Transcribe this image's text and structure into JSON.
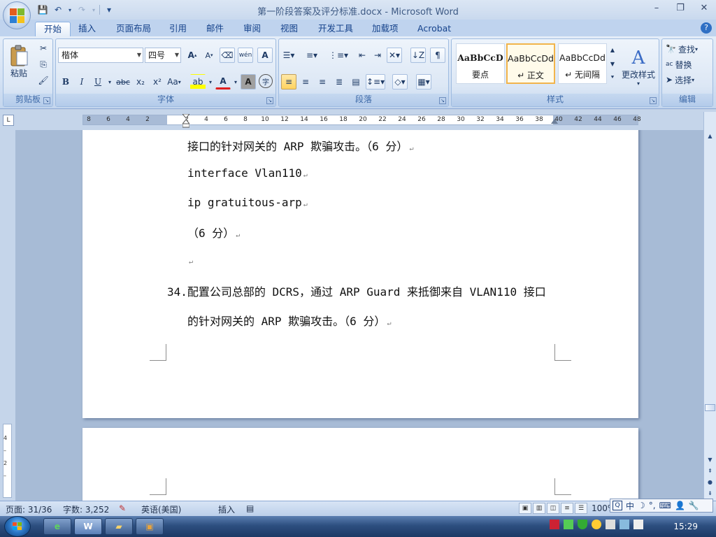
{
  "window": {
    "title": "第一阶段答案及评分标准.docx - Microsoft Word",
    "minimize": "–",
    "restore": "❐",
    "close": "✕"
  },
  "qat": {
    "save": "💾",
    "undo": "↶",
    "redo": "↷",
    "customize": "▾"
  },
  "tabs": [
    "开始",
    "插入",
    "页面布局",
    "引用",
    "邮件",
    "审阅",
    "视图",
    "开发工具",
    "加载项",
    "Acrobat"
  ],
  "ribbon": {
    "clipboard": {
      "label": "剪贴板",
      "paste": "粘贴"
    },
    "font": {
      "label": "字体",
      "font_name": "楷体",
      "font_size": "四号",
      "grow": "A",
      "shrink": "A",
      "phonetic": "wén",
      "bold": "B",
      "italic": "I",
      "underline": "U",
      "strike": "abc",
      "subscript": "x₂",
      "superscript": "x²",
      "change_case": "Aa",
      "highlight": "ab",
      "font_color": "A",
      "char_shading": "A",
      "enclose": "字"
    },
    "paragraph": {
      "label": "段落"
    },
    "styles": {
      "label": "样式",
      "items": [
        {
          "sample": "AaBbCcD",
          "name": "要点"
        },
        {
          "sample": "AaBbCcDd",
          "name": "↵ 正文"
        },
        {
          "sample": "AaBbCcDd",
          "name": "↵ 无间隔"
        }
      ],
      "change_styles": "更改样式"
    },
    "editing": {
      "label": "编辑",
      "find": "查找",
      "replace": "替换",
      "select": "选择"
    }
  },
  "ruler": {
    "ticks": [
      "8",
      "6",
      "4",
      "2",
      "",
      "2",
      "4",
      "6",
      "8",
      "10",
      "12",
      "14",
      "16",
      "18",
      "20",
      "22",
      "24",
      "26",
      "28",
      "30",
      "32",
      "34",
      "36",
      "38",
      "40",
      "42",
      "44",
      "46",
      "48"
    ],
    "tab_selector": "L"
  },
  "vruler": {
    "ticks": [
      "4",
      "2",
      "2"
    ]
  },
  "document": {
    "lines": [
      "接口的针对网关的 ARP 欺骗攻击。（6 分）",
      "interface Vlan110",
      "ip gratuitous-arp",
      "（6 分）",
      "",
      "34.配置公司总部的 DCRS，通过 ARP Guard 来抵御来自 VLAN110 接口",
      "的针对网关的 ARP 欺骗攻击。（6 分）"
    ],
    "para_mark": "↵"
  },
  "status": {
    "page": "页面: 31/36",
    "words": "字数: 3,252",
    "language": "英语(美国)",
    "mode": "插入",
    "zoom": "100%"
  },
  "ime": {
    "mode": "中",
    "moon": "☽",
    "punct": "°,",
    "keyboard": "⌨",
    "user": "👤",
    "tools": "🔧"
  },
  "taskbar": {
    "clock": "15:29"
  }
}
